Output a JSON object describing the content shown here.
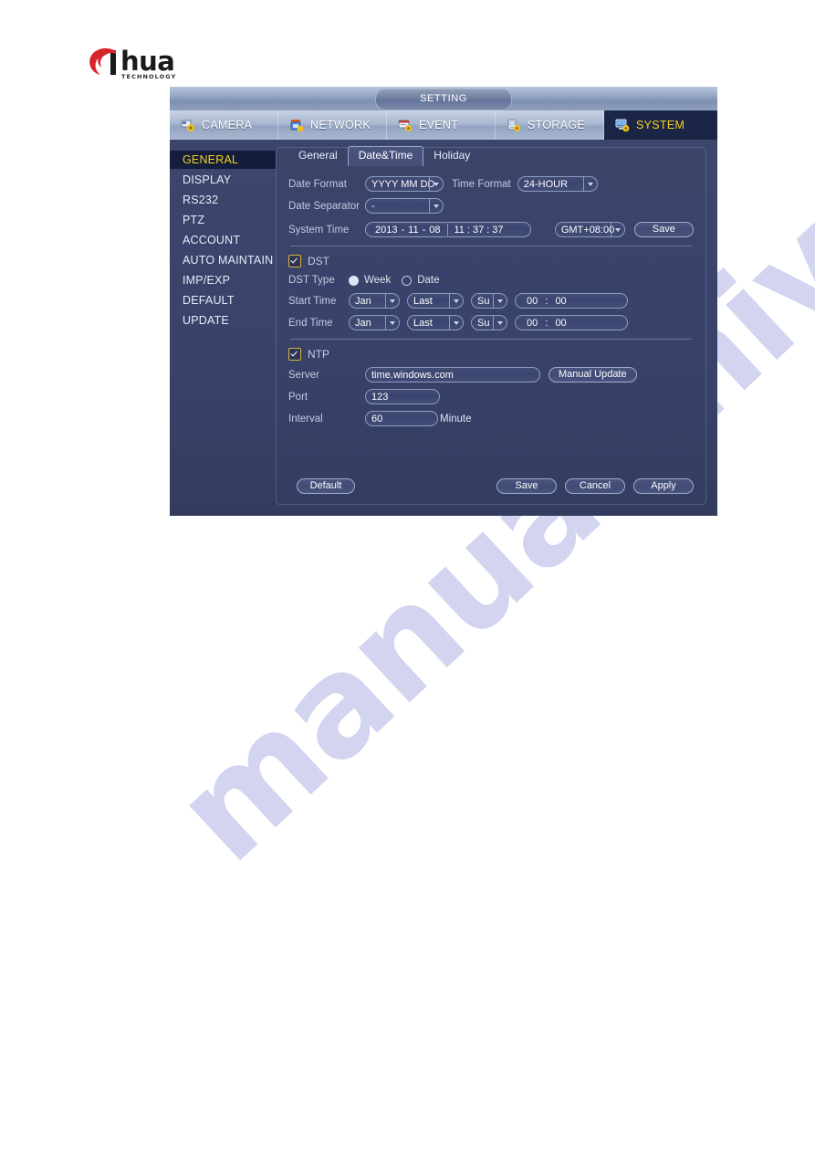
{
  "logo": {
    "brand": "alhua",
    "wordmark": "hua",
    "tagline": "TECHNOLOGY"
  },
  "watermark": {
    "text": "manualshive.com"
  },
  "window": {
    "title": "SETTING"
  },
  "top_tabs": [
    {
      "label": "CAMERA",
      "icon": "camera-gear-icon",
      "active": false
    },
    {
      "label": "NETWORK",
      "icon": "network-gear-icon",
      "active": false
    },
    {
      "label": "EVENT",
      "icon": "event-gear-icon",
      "active": false
    },
    {
      "label": "STORAGE",
      "icon": "storage-gear-icon",
      "active": false
    },
    {
      "label": "SYSTEM",
      "icon": "system-gear-icon",
      "active": true
    }
  ],
  "sidebar": {
    "items": [
      {
        "label": "GENERAL",
        "active": true
      },
      {
        "label": "DISPLAY",
        "active": false
      },
      {
        "label": "RS232",
        "active": false
      },
      {
        "label": "PTZ",
        "active": false
      },
      {
        "label": "ACCOUNT",
        "active": false
      },
      {
        "label": "AUTO MAINTAIN",
        "active": false
      },
      {
        "label": "IMP/EXP",
        "active": false
      },
      {
        "label": "DEFAULT",
        "active": false
      },
      {
        "label": "UPDATE",
        "active": false
      }
    ]
  },
  "sub_tabs": [
    {
      "label": "General",
      "active": false
    },
    {
      "label": "Date&Time",
      "active": true
    },
    {
      "label": "Holiday",
      "active": false
    }
  ],
  "form": {
    "date_format": {
      "label": "Date Format",
      "value": "YYYY MM DD"
    },
    "time_format": {
      "label": "Time Format",
      "value": "24-HOUR"
    },
    "date_separator": {
      "label": "Date Separator",
      "value": "-"
    },
    "system_time": {
      "label": "System Time",
      "year": "2013",
      "month": "11",
      "day": "08",
      "hour": "11",
      "minute": "37",
      "second": "37",
      "sep_date": "-",
      "sep_time": ":"
    },
    "timezone": {
      "value": "GMT+08:00"
    },
    "save_time_button": "Save",
    "dst": {
      "label": "DST",
      "checked": true,
      "type_label": "DST Type",
      "type_week": "Week",
      "type_date": "Date",
      "type_selected": "Week",
      "start": {
        "label": "Start Time",
        "month": "Jan",
        "week": "Last",
        "day": "Su",
        "hour": "00",
        "minute": "00",
        "sep": ":"
      },
      "end": {
        "label": "End Time",
        "month": "Jan",
        "week": "Last",
        "day": "Su",
        "hour": "00",
        "minute": "00",
        "sep": ":"
      }
    },
    "ntp": {
      "label": "NTP",
      "checked": true,
      "server_label": "Server",
      "server_value": "time.windows.com",
      "manual_update_button": "Manual Update",
      "port_label": "Port",
      "port_value": "123",
      "interval_label": "Interval",
      "interval_value": "60",
      "interval_unit": "Minute"
    }
  },
  "footer": {
    "default": "Default",
    "save": "Save",
    "cancel": "Cancel",
    "apply": "Apply"
  },
  "colors": {
    "accent_yellow": "#f5d020",
    "panel_blue": "#39426a",
    "tab_active": "#1c2748",
    "logo_red": "#d7242a",
    "watermark": "#b9bce8"
  }
}
